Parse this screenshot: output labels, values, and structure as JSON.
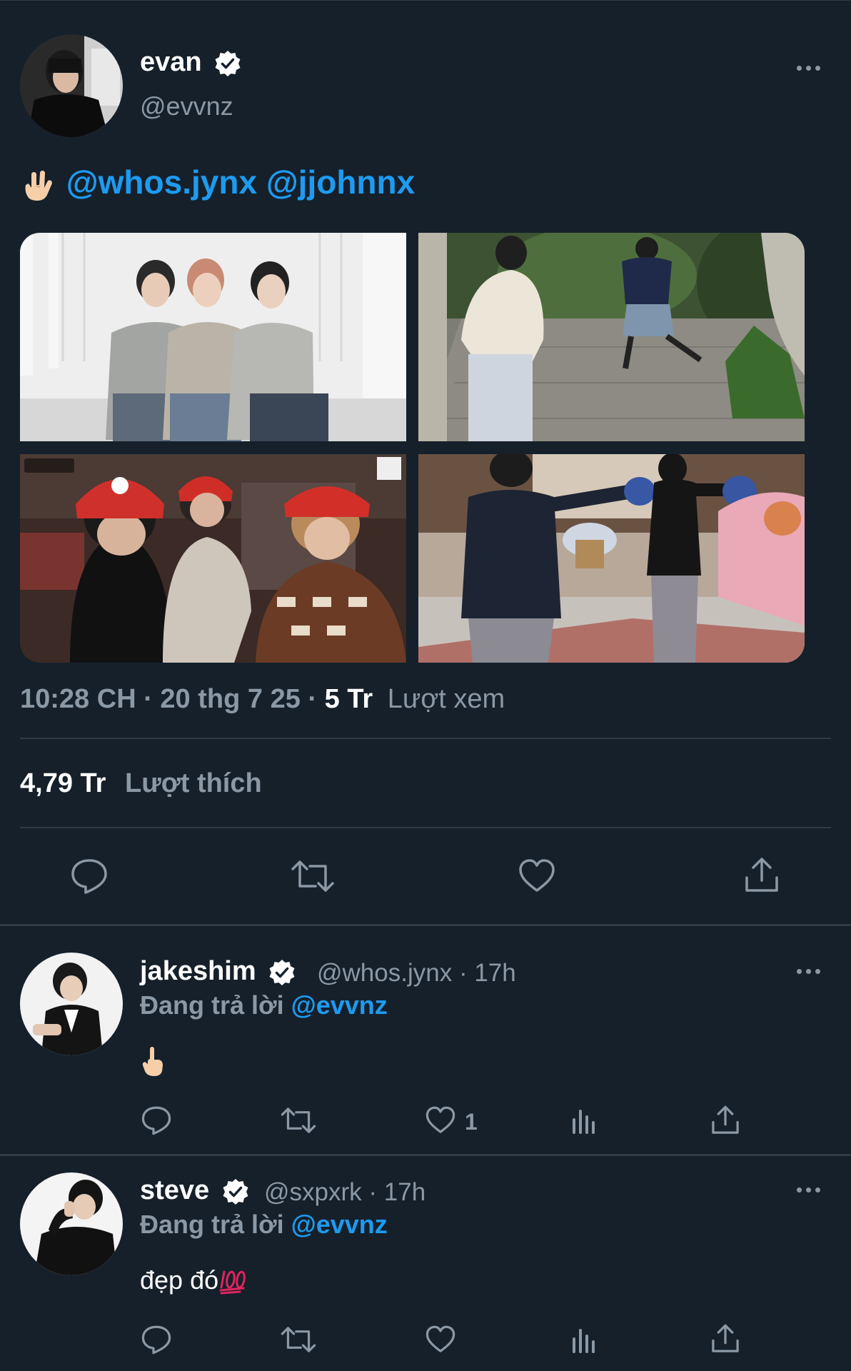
{
  "main_tweet": {
    "author": {
      "name": "evan",
      "handle": "@evvnz",
      "verified": true
    },
    "text": {
      "emoji": "rock-on-hand-icon",
      "mentions": [
        "@whos.jynx",
        "@jjohnnx"
      ]
    },
    "media_count": 4,
    "meta": {
      "time": "10:28 CH",
      "sep1": "·",
      "date": "20 thg 7 25",
      "sep2": "·",
      "views": "5 Tr",
      "views_label": "Lượt xem"
    },
    "likes": {
      "count": "4,79 Tr",
      "label": "Lượt thích"
    },
    "actions": [
      "reply-icon",
      "retweet-icon",
      "like-icon",
      "share-icon"
    ]
  },
  "replies": [
    {
      "name": "jakeshim",
      "handle": "@whos.jynx",
      "sep": "·",
      "time": "17h",
      "verified": true,
      "replying_prefix": "Đang trả lời",
      "replying_to": "@evvnz",
      "body": "",
      "body_emoji": "pointing-up-hand-icon",
      "like_count": "1"
    },
    {
      "name": "steve",
      "handle": "@sxpxrk",
      "sep": "·",
      "time": "17h",
      "verified": true,
      "replying_prefix": "Đang trả lời",
      "replying_to": "@evvnz",
      "body": "đẹp đó",
      "body_emoji": "hundred-points-icon",
      "like_count": ""
    }
  ],
  "colors": {
    "background": "#15202b",
    "accent": "#1d9bf0",
    "secondary_text": "#8b98a5",
    "divider": "#2f3b47"
  }
}
